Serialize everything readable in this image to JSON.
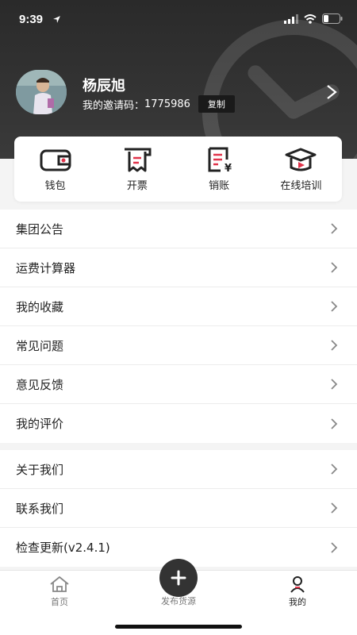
{
  "status_bar": {
    "time": "9:39"
  },
  "profile": {
    "name": "杨辰旭",
    "invite_label": "我的邀请码：",
    "invite_code": "1775986",
    "copy_label": "复制"
  },
  "actions": [
    {
      "label": "钱包",
      "icon": "wallet-icon"
    },
    {
      "label": "开票",
      "icon": "invoice-icon"
    },
    {
      "label": "销账",
      "icon": "write-off-icon"
    },
    {
      "label": "在线培训",
      "icon": "graduation-cap-icon"
    }
  ],
  "menu_group_1": [
    {
      "label": "集团公告"
    },
    {
      "label": "运费计算器"
    },
    {
      "label": "我的收藏"
    },
    {
      "label": "常见问题"
    },
    {
      "label": "意见反馈"
    },
    {
      "label": "我的评价"
    }
  ],
  "menu_group_2": [
    {
      "label": "关于我们"
    },
    {
      "label": "联系我们"
    },
    {
      "label": "检查更新(v2.4.1)"
    }
  ],
  "tabbar": {
    "home": "首页",
    "publish": "发布货源",
    "mine": "我的"
  },
  "colors": {
    "header_bg": "#2a2a2a",
    "accent_red": "#e0334a"
  }
}
